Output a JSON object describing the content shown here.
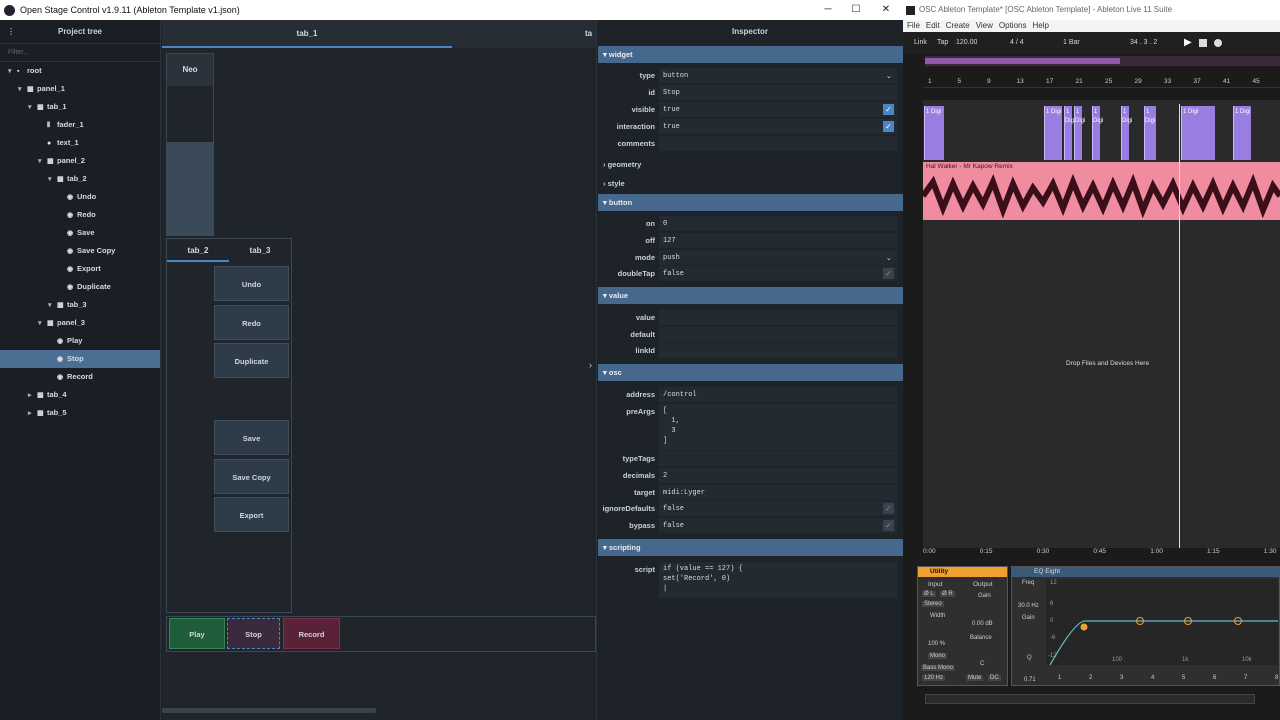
{
  "osc": {
    "title": "Open Stage Control v1.9.11 (Ableton Template v1.json)",
    "win_min": "─",
    "win_max": "☐",
    "win_close": "✕",
    "tree": {
      "header": "Project tree",
      "filter_placeholder": "Filter...",
      "items": [
        {
          "label": "root",
          "depth": 0,
          "caret": "▾",
          "icon": "▪"
        },
        {
          "label": "panel_1",
          "depth": 1,
          "caret": "▾",
          "icon": "▦"
        },
        {
          "label": "tab_1",
          "depth": 2,
          "caret": "▾",
          "icon": "▦"
        },
        {
          "label": "fader_1",
          "depth": 3,
          "caret": "",
          "icon": "⦀"
        },
        {
          "label": "text_1",
          "depth": 3,
          "caret": "",
          "icon": "●"
        },
        {
          "label": "panel_2",
          "depth": 3,
          "caret": "▾",
          "icon": "▦"
        },
        {
          "label": "tab_2",
          "depth": 4,
          "caret": "▾",
          "icon": "▦"
        },
        {
          "label": "Undo",
          "depth": 5,
          "caret": "",
          "icon": "◉"
        },
        {
          "label": "Redo",
          "depth": 5,
          "caret": "",
          "icon": "◉"
        },
        {
          "label": "Save",
          "depth": 5,
          "caret": "",
          "icon": "◉"
        },
        {
          "label": "Save Copy",
          "depth": 5,
          "caret": "",
          "icon": "◉"
        },
        {
          "label": "Export",
          "depth": 5,
          "caret": "",
          "icon": "◉"
        },
        {
          "label": "Duplicate",
          "depth": 5,
          "caret": "",
          "icon": "◉"
        },
        {
          "label": "tab_3",
          "depth": 4,
          "caret": "▾",
          "icon": "▦"
        },
        {
          "label": "panel_3",
          "depth": 3,
          "caret": "▾",
          "icon": "▦"
        },
        {
          "label": "Play",
          "depth": 4,
          "caret": "",
          "icon": "◉"
        },
        {
          "label": "Stop",
          "depth": 4,
          "caret": "",
          "icon": "◉",
          "selected": true
        },
        {
          "label": "Record",
          "depth": 4,
          "caret": "",
          "icon": "◉"
        },
        {
          "label": "tab_4",
          "depth": 2,
          "caret": "▸",
          "icon": "▦"
        },
        {
          "label": "tab_5",
          "depth": 2,
          "caret": "▸",
          "icon": "▦"
        }
      ]
    },
    "canvas": {
      "tab_main": "tab_1",
      "tab_cut": "ta",
      "neo_label": "Neo",
      "tab2": "tab_2",
      "tab3": "tab_3",
      "buttons": [
        "Undo",
        "Redo",
        "Duplicate",
        "Save",
        "Save Copy",
        "Export"
      ],
      "play": "Play",
      "stop": "Stop",
      "record": "Record"
    },
    "inspector": {
      "title": "Inspector",
      "sections": {
        "widget": "widget",
        "geometry": "geometry",
        "style": "style",
        "button": "button",
        "value": "value",
        "osc": "osc",
        "scripting": "scripting"
      },
      "widget": {
        "type": "button",
        "id": "Stop",
        "visible": "true",
        "interaction": "true",
        "comments": ""
      },
      "button": {
        "on": "0",
        "off": "127",
        "mode": "push",
        "doubleTap": "false"
      },
      "value": {
        "value": "",
        "default": "",
        "linkId": ""
      },
      "osc": {
        "address": "/control",
        "preArgs_l1": "[",
        "preArgs_l2": "  1,",
        "preArgs_l3": "  3",
        "preArgs_l4": "]",
        "typeTags": "",
        "decimals": "2",
        "target": "midi:Lyger",
        "ignoreDefaults": "false",
        "bypass": "false"
      },
      "scripting": {
        "script_l1": "if (value == 127) {",
        "script_l2": "set('Record', 0)"
      }
    },
    "labels": {
      "type": "type",
      "id": "id",
      "visible": "visible",
      "interaction": "interaction",
      "comments": "comments",
      "on": "on",
      "off": "off",
      "mode": "mode",
      "doubleTap": "doubleTap",
      "value": "value",
      "default": "default",
      "linkId": "linkId",
      "address": "address",
      "preArgs": "preArgs",
      "typeTags": "typeTags",
      "decimals": "decimals",
      "target": "target",
      "ignoreDefaults": "ignoreDefaults",
      "bypass": "bypass",
      "script": "script"
    }
  },
  "ableton": {
    "title": "OSC Ableton Template* [OSC Ableton Template] - Ableton Live 11 Suite",
    "menu": [
      "File",
      "Edit",
      "Create",
      "View",
      "Options",
      "Help"
    ],
    "link": "Link",
    "tap": "Tap",
    "tempo": "120.00",
    "sig": "4 / 4",
    "quant": "1 Bar",
    "pos": "34 .  3 .  2",
    "ruler": [
      "1",
      "5",
      "9",
      "13",
      "17",
      "21",
      "25",
      "29",
      "33",
      "37",
      "41",
      "45"
    ],
    "clip_lbl": "1 Digi",
    "audio_track": "Hal Walker - Mr Kapow Remix",
    "drop": "Drop Files and Devices Here",
    "times": [
      "0:00",
      "0:15",
      "0:30",
      "0:45",
      "1:00",
      "1:15",
      "1:30"
    ],
    "utility": {
      "name": "Utility",
      "input": "Input",
      "output": "Output",
      "phase_l": "Ø L",
      "phase_r": "Ø R",
      "stereo": "Stereo",
      "width": "Width",
      "width_val": "100 %",
      "gain": "Gain",
      "gain_val": "0.00 dB",
      "balance": "Balance",
      "balance_val": "C",
      "mono": "Mono",
      "bass_mono": "Bass Mono",
      "hz": "120 Hz",
      "mute": "Mute",
      "dc": "DC"
    },
    "eq": {
      "name": "EQ Eight",
      "freq": "Freq",
      "freq_val": "30.0 Hz",
      "gain": "Gain",
      "q": "Q",
      "q_val": "0.71",
      "db12": "12",
      "db6": "6",
      "db0": "0",
      "dbm6": "-6",
      "dbm12": "-12",
      "f100": "100",
      "f1k": "1k",
      "f10k": "10k",
      "bands": [
        "1",
        "2",
        "3",
        "4",
        "5",
        "6",
        "7",
        "8"
      ]
    },
    "colors": {
      "clip": "#9a7de0",
      "audio": "#f08ca0",
      "eq_curve": "#5ec4c9",
      "eq_point": "#f0a030"
    }
  }
}
